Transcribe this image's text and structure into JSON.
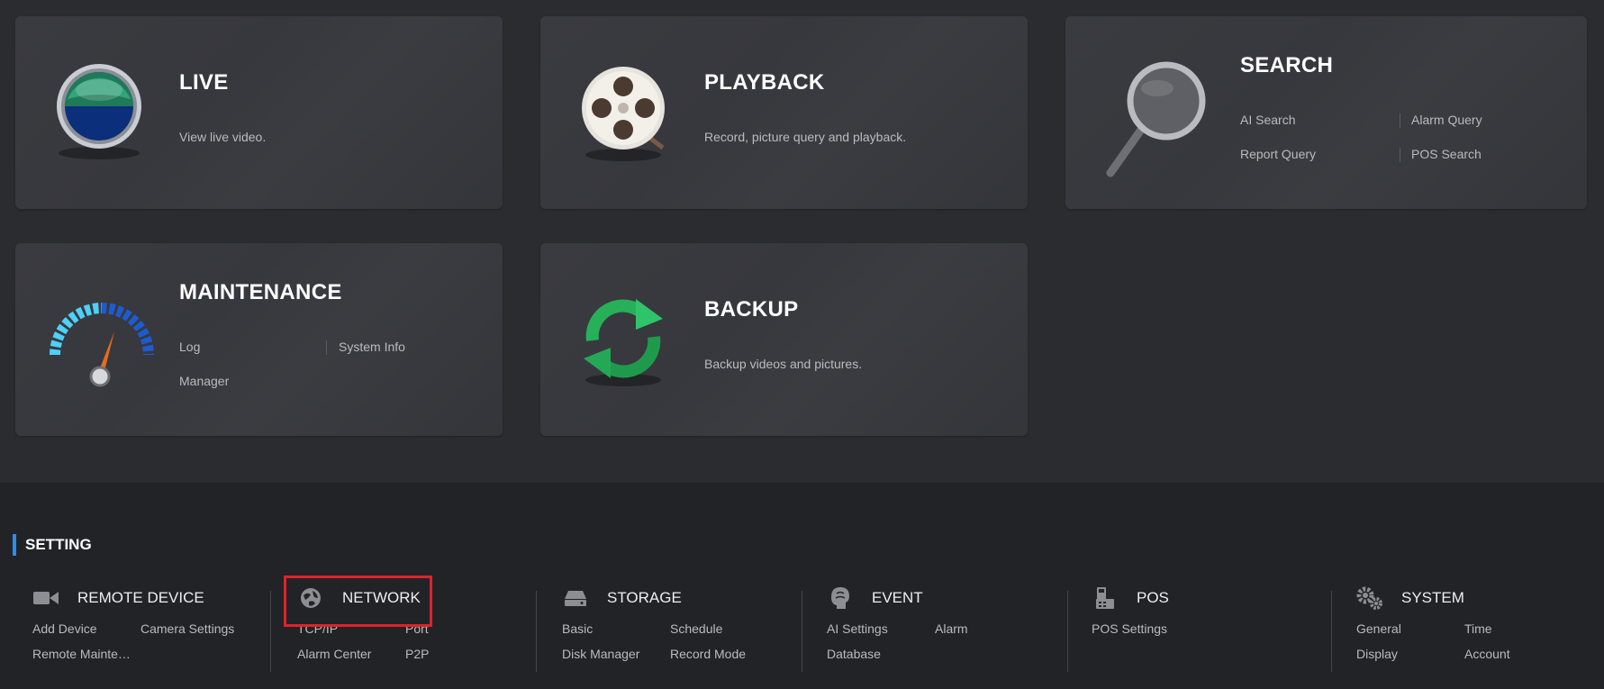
{
  "cards": {
    "live": {
      "title": "LIVE",
      "desc": "View live video."
    },
    "playback": {
      "title": "PLAYBACK",
      "desc": "Record, picture query and playback."
    },
    "search": {
      "title": "SEARCH",
      "links": [
        "AI Search",
        "Alarm Query",
        "Report Query",
        "POS Search"
      ]
    },
    "maintenance": {
      "title": "MAINTENANCE",
      "links": [
        "Log",
        "System Info",
        "Manager"
      ]
    },
    "backup": {
      "title": "BACKUP",
      "desc": "Backup videos and pictures."
    }
  },
  "setting": {
    "heading": "SETTING",
    "groups": [
      {
        "title": "REMOTE DEVICE",
        "icon": "camera-icon",
        "items": [
          "Add Device",
          "Camera Settings",
          "Remote Mainte…"
        ]
      },
      {
        "title": "NETWORK",
        "icon": "globe-icon",
        "items": [
          "TCP/IP",
          "Port",
          "Alarm Center",
          "P2P"
        ]
      },
      {
        "title": "STORAGE",
        "icon": "hdd-icon",
        "items": [
          "Basic",
          "Schedule",
          "Disk Manager",
          "Record Mode"
        ]
      },
      {
        "title": "EVENT",
        "icon": "brain-icon",
        "items": [
          "AI Settings",
          "Alarm",
          "Database"
        ]
      },
      {
        "title": "POS",
        "icon": "pos-terminal-icon",
        "items": [
          "POS Settings"
        ]
      },
      {
        "title": "SYSTEM",
        "icon": "gears-icon",
        "items": [
          "General",
          "Time",
          "Display",
          "Account"
        ]
      }
    ]
  },
  "colors": {
    "accent": "#2d8cf0",
    "highlight": "#e0222a"
  }
}
